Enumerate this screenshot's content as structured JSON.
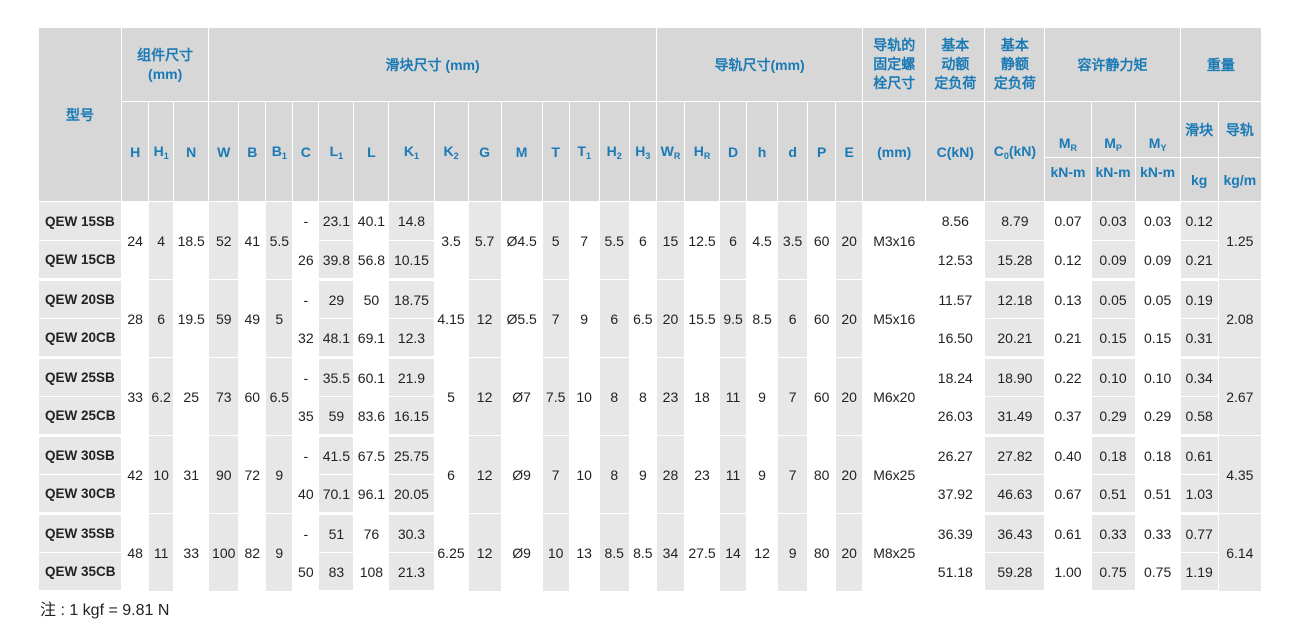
{
  "header": {
    "model": "型号",
    "assembly": "组件尺寸 (mm)",
    "block": "滑块尺寸 (mm)",
    "rail": "导轨尺寸(mm)",
    "bolt_line1": "导轨的",
    "bolt_line2": "固定螺",
    "bolt_line3": "栓尺寸",
    "bolt_unit": "(mm)",
    "dyn_line1": "基本",
    "dyn_line2": "动额",
    "dyn_line3": "定负荷",
    "dyn_unit": "C(kN)",
    "sta_line1": "基本",
    "sta_line2": "静额",
    "sta_line3": "定负荷",
    "sta_unit_main": "C",
    "sta_unit_sub": "0",
    "sta_unit_tail": "(kN)",
    "moment": "容许静力矩",
    "weight": "重量",
    "block_w": "滑块",
    "rail_w": "导轨",
    "unit_knm": "kN-m",
    "unit_kg": "kg",
    "unit_kgm": "kg/m",
    "cols": [
      {
        "main": "H",
        "sub": ""
      },
      {
        "main": "H",
        "sub": "1"
      },
      {
        "main": "N",
        "sub": ""
      },
      {
        "main": "W",
        "sub": ""
      },
      {
        "main": "B",
        "sub": ""
      },
      {
        "main": "B",
        "sub": "1"
      },
      {
        "main": "C",
        "sub": ""
      },
      {
        "main": "L",
        "sub": "1"
      },
      {
        "main": "L",
        "sub": ""
      },
      {
        "main": "K",
        "sub": "1"
      },
      {
        "main": "K",
        "sub": "2"
      },
      {
        "main": "G",
        "sub": ""
      },
      {
        "main": "M",
        "sub": ""
      },
      {
        "main": "T",
        "sub": ""
      },
      {
        "main": "T",
        "sub": "1"
      },
      {
        "main": "H",
        "sub": "2"
      },
      {
        "main": "H",
        "sub": "3"
      },
      {
        "main": "W",
        "sub": "R"
      },
      {
        "main": "H",
        "sub": "R"
      },
      {
        "main": "D",
        "sub": ""
      },
      {
        "main": "h",
        "sub": ""
      },
      {
        "main": "d",
        "sub": ""
      },
      {
        "main": "P",
        "sub": ""
      },
      {
        "main": "E",
        "sub": ""
      }
    ],
    "moments": [
      {
        "main": "M",
        "sub": "R"
      },
      {
        "main": "M",
        "sub": "P"
      },
      {
        "main": "M",
        "sub": "Y"
      }
    ]
  },
  "groups": [
    {
      "H": "24",
      "H1": "4",
      "N": "18.5",
      "W": "52",
      "B": "41",
      "B1": "5.5",
      "K2": "3.5",
      "G": "5.7",
      "M": "Ø4.5",
      "T": "5",
      "T1": "7",
      "H2": "5.5",
      "H3": "6",
      "WR": "15",
      "HR": "12.5",
      "D": "6",
      "h": "4.5",
      "d": "3.5",
      "P": "60",
      "E": "20",
      "bolt": "M3x16",
      "rail_kg": "1.25",
      "rows": [
        {
          "model": "QEW 15SB",
          "C": "-",
          "L1": "23.1",
          "L": "40.1",
          "K1": "14.8",
          "Cdyn": "8.56",
          "C0": "8.79",
          "MR": "0.07",
          "MP": "0.03",
          "MY": "0.03",
          "kg": "0.12"
        },
        {
          "model": "QEW 15CB",
          "C": "26",
          "L1": "39.8",
          "L": "56.8",
          "K1": "10.15",
          "Cdyn": "12.53",
          "C0": "15.28",
          "MR": "0.12",
          "MP": "0.09",
          "MY": "0.09",
          "kg": "0.21"
        }
      ]
    },
    {
      "H": "28",
      "H1": "6",
      "N": "19.5",
      "W": "59",
      "B": "49",
      "B1": "5",
      "K2": "4.15",
      "G": "12",
      "M": "Ø5.5",
      "T": "7",
      "T1": "9",
      "H2": "6",
      "H3": "6.5",
      "WR": "20",
      "HR": "15.5",
      "D": "9.5",
      "h": "8.5",
      "d": "6",
      "P": "60",
      "E": "20",
      "bolt": "M5x16",
      "rail_kg": "2.08",
      "rows": [
        {
          "model": "QEW 20SB",
          "C": "-",
          "L1": "29",
          "L": "50",
          "K1": "18.75",
          "Cdyn": "11.57",
          "C0": "12.18",
          "MR": "0.13",
          "MP": "0.05",
          "MY": "0.05",
          "kg": "0.19"
        },
        {
          "model": "QEW 20CB",
          "C": "32",
          "L1": "48.1",
          "L": "69.1",
          "K1": "12.3",
          "Cdyn": "16.50",
          "C0": "20.21",
          "MR": "0.21",
          "MP": "0.15",
          "MY": "0.15",
          "kg": "0.31"
        }
      ]
    },
    {
      "H": "33",
      "H1": "6.2",
      "N": "25",
      "W": "73",
      "B": "60",
      "B1": "6.5",
      "K2": "5",
      "G": "12",
      "M": "Ø7",
      "T": "7.5",
      "T1": "10",
      "H2": "8",
      "H3": "8",
      "WR": "23",
      "HR": "18",
      "D": "11",
      "h": "9",
      "d": "7",
      "P": "60",
      "E": "20",
      "bolt": "M6x20",
      "rail_kg": "2.67",
      "rows": [
        {
          "model": "QEW 25SB",
          "C": "-",
          "L1": "35.5",
          "L": "60.1",
          "K1": "21.9",
          "Cdyn": "18.24",
          "C0": "18.90",
          "MR": "0.22",
          "MP": "0.10",
          "MY": "0.10",
          "kg": "0.34"
        },
        {
          "model": "QEW 25CB",
          "C": "35",
          "L1": "59",
          "L": "83.6",
          "K1": "16.15",
          "Cdyn": "26.03",
          "C0": "31.49",
          "MR": "0.37",
          "MP": "0.29",
          "MY": "0.29",
          "kg": "0.58"
        }
      ]
    },
    {
      "H": "42",
      "H1": "10",
      "N": "31",
      "W": "90",
      "B": "72",
      "B1": "9",
      "K2": "6",
      "G": "12",
      "M": "Ø9",
      "T": "7",
      "T1": "10",
      "H2": "8",
      "H3": "9",
      "WR": "28",
      "HR": "23",
      "D": "11",
      "h": "9",
      "d": "7",
      "P": "80",
      "E": "20",
      "bolt": "M6x25",
      "rail_kg": "4.35",
      "rows": [
        {
          "model": "QEW 30SB",
          "C": "-",
          "L1": "41.5",
          "L": "67.5",
          "K1": "25.75",
          "Cdyn": "26.27",
          "C0": "27.82",
          "MR": "0.40",
          "MP": "0.18",
          "MY": "0.18",
          "kg": "0.61"
        },
        {
          "model": "QEW 30CB",
          "C": "40",
          "L1": "70.1",
          "L": "96.1",
          "K1": "20.05",
          "Cdyn": "37.92",
          "C0": "46.63",
          "MR": "0.67",
          "MP": "0.51",
          "MY": "0.51",
          "kg": "1.03"
        }
      ]
    },
    {
      "H": "48",
      "H1": "11",
      "N": "33",
      "W": "100",
      "B": "82",
      "B1": "9",
      "K2": "6.25",
      "G": "12",
      "M": "Ø9",
      "T": "10",
      "T1": "13",
      "H2": "8.5",
      "H3": "8.5",
      "WR": "34",
      "HR": "27.5",
      "D": "14",
      "h": "12",
      "d": "9",
      "P": "80",
      "E": "20",
      "bolt": "M8x25",
      "rail_kg": "6.14",
      "rows": [
        {
          "model": "QEW 35SB",
          "C": "-",
          "L1": "51",
          "L": "76",
          "K1": "30.3",
          "Cdyn": "36.39",
          "C0": "36.43",
          "MR": "0.61",
          "MP": "0.33",
          "MY": "0.33",
          "kg": "0.77"
        },
        {
          "model": "QEW 35CB",
          "C": "50",
          "L1": "83",
          "L": "108",
          "K1": "21.3",
          "Cdyn": "51.18",
          "C0": "59.28",
          "MR": "1.00",
          "MP": "0.75",
          "MY": "0.75",
          "kg": "1.19"
        }
      ]
    }
  ],
  "note": "注 : 1 kgf = 9.81 N"
}
